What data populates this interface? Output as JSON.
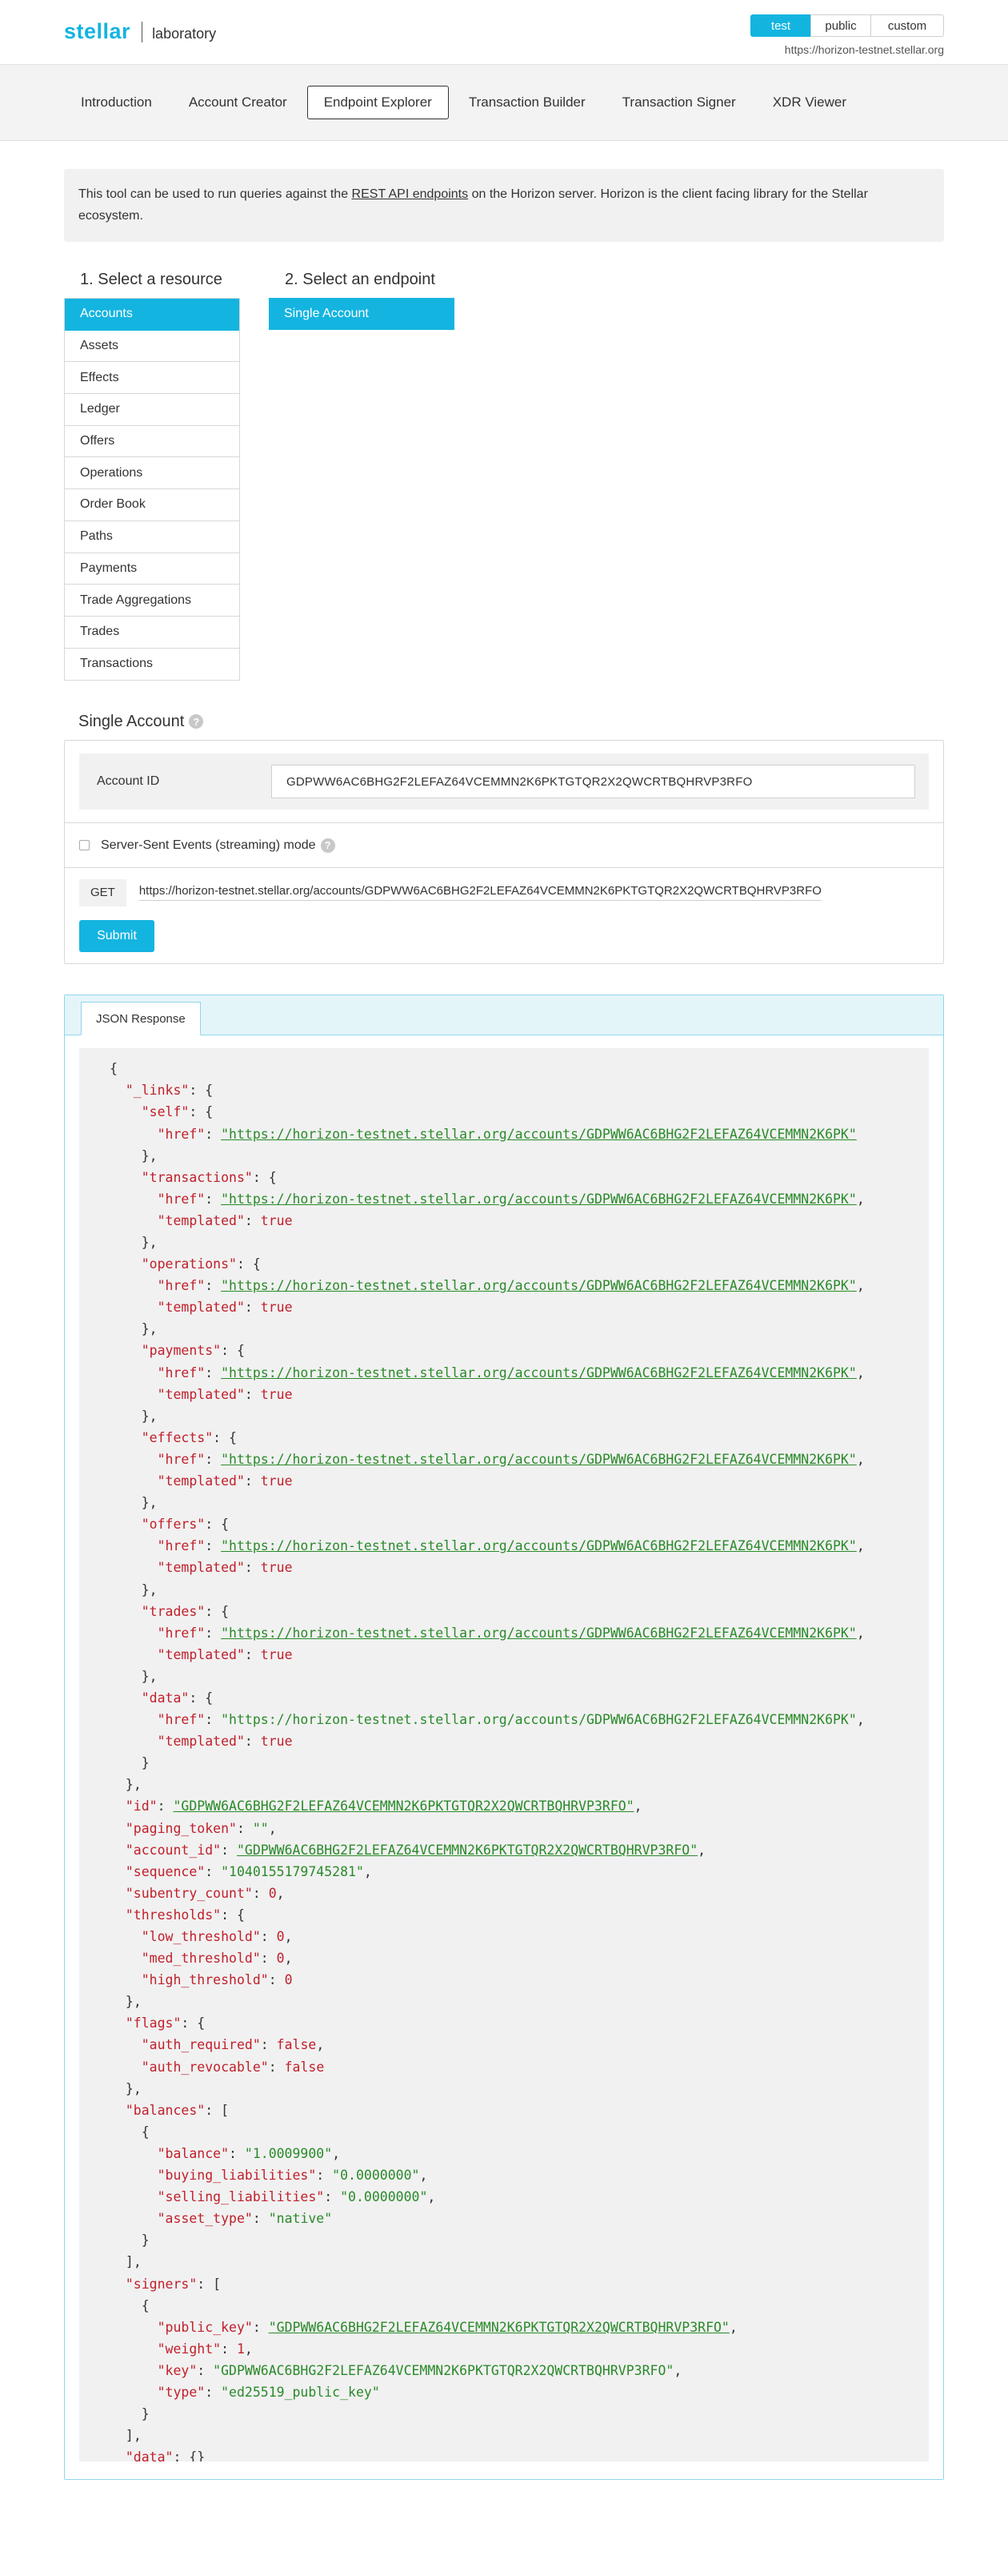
{
  "header": {
    "logo_main": "stellar",
    "logo_sub": "laboratory",
    "networks": [
      "test",
      "public",
      "custom"
    ],
    "active_network": "test",
    "horizon_url": "https://horizon-testnet.stellar.org"
  },
  "nav": {
    "items": [
      "Introduction",
      "Account Creator",
      "Endpoint Explorer",
      "Transaction Builder",
      "Transaction Signer",
      "XDR Viewer"
    ],
    "active": "Endpoint Explorer"
  },
  "intro": {
    "before_link": "This tool can be used to run queries against the ",
    "link": "REST API endpoints",
    "after_link": " on the Horizon server. Horizon is the client facing library for the Stellar ecosystem."
  },
  "resources": {
    "title": "1. Select a resource",
    "items": [
      "Accounts",
      "Assets",
      "Effects",
      "Ledger",
      "Offers",
      "Operations",
      "Order Book",
      "Paths",
      "Payments",
      "Trade Aggregations",
      "Trades",
      "Transactions"
    ],
    "active": "Accounts"
  },
  "endpoints": {
    "title": "2. Select an endpoint",
    "items": [
      "Single Account"
    ],
    "active": "Single Account"
  },
  "form": {
    "title": "Single Account",
    "account_id_label": "Account ID",
    "account_id_value": "GDPWW6AC6BHG2F2LEFAZ64VCEMMN2K6PKTGTQR2X2QWCRTBQHRVP3RFO",
    "streaming_label": "Server-Sent Events (streaming) mode",
    "method": "GET",
    "request_url": "https://horizon-testnet.stellar.org/accounts/GDPWW6AC6BHG2F2LEFAZ64VCEMMN2K6PKTGTQR2X2QWCRTBQHRVP3RFO",
    "submit_label": "Submit"
  },
  "response": {
    "tab_label": "JSON Response",
    "json": {
      "_links": {
        "self": {
          "href": "https://horizon-testnet.stellar.org/accounts/GDPWW6AC6BHG2F2LEFAZ64VCEMMN2K6PK"
        },
        "transactions": {
          "href": "https://horizon-testnet.stellar.org/accounts/GDPWW6AC6BHG2F2LEFAZ64VCEMMN2K6PK",
          "templated": true
        },
        "operations": {
          "href": "https://horizon-testnet.stellar.org/accounts/GDPWW6AC6BHG2F2LEFAZ64VCEMMN2K6PK",
          "templated": true
        },
        "payments": {
          "href": "https://horizon-testnet.stellar.org/accounts/GDPWW6AC6BHG2F2LEFAZ64VCEMMN2K6PK",
          "templated": true
        },
        "effects": {
          "href": "https://horizon-testnet.stellar.org/accounts/GDPWW6AC6BHG2F2LEFAZ64VCEMMN2K6PK",
          "templated": true
        },
        "offers": {
          "href": "https://horizon-testnet.stellar.org/accounts/GDPWW6AC6BHG2F2LEFAZ64VCEMMN2K6PK",
          "templated": true
        },
        "trades": {
          "href": "https://horizon-testnet.stellar.org/accounts/GDPWW6AC6BHG2F2LEFAZ64VCEMMN2K6PK",
          "templated": true
        },
        "data": {
          "href": "https://horizon-testnet.stellar.org/accounts/GDPWW6AC6BHG2F2LEFAZ64VCEMMN2K6PK",
          "templated": true
        }
      },
      "id": "GDPWW6AC6BHG2F2LEFAZ64VCEMMN2K6PKTGTQR2X2QWCRTBQHRVP3RFO",
      "paging_token": "",
      "account_id": "GDPWW6AC6BHG2F2LEFAZ64VCEMMN2K6PKTGTQR2X2QWCRTBQHRVP3RFO",
      "sequence": "1040155179745281",
      "subentry_count": 0,
      "thresholds": {
        "low_threshold": 0,
        "med_threshold": 0,
        "high_threshold": 0
      },
      "flags": {
        "auth_required": false,
        "auth_revocable": false
      },
      "balances": [
        {
          "balance": "1.0009900",
          "buying_liabilities": "0.0000000",
          "selling_liabilities": "0.0000000",
          "asset_type": "native"
        }
      ],
      "signers": [
        {
          "public_key": "GDPWW6AC6BHG2F2LEFAZ64VCEMMN2K6PKTGTQR2X2QWCRTBQHRVP3RFO",
          "weight": 1,
          "key": "GDPWW6AC6BHG2F2LEFAZ64VCEMMN2K6PKTGTQR2X2QWCRTBQHRVP3RFO",
          "type": "ed25519_public_key"
        }
      ],
      "data": {}
    }
  },
  "colors": {
    "accent": "#14b4e0",
    "json_key": "#c0202b",
    "json_string": "#2a8a2a"
  }
}
